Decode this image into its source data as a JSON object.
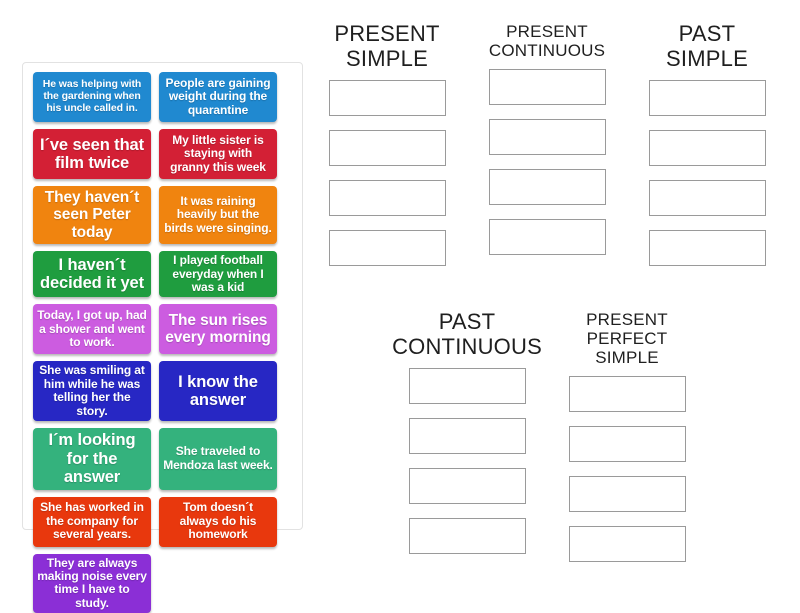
{
  "activity": {
    "type": "drag-and-drop-group-sort",
    "card_bank": {
      "cards": [
        {
          "text": "He was helping with the gardening when his uncle called in.",
          "color": "#2089d0",
          "size": "sm"
        },
        {
          "text": "People are gaining weight during the quarantine",
          "color": "#2089d0",
          "size": "md"
        },
        {
          "text": "I´ve seen that film twice",
          "color": "#d32035",
          "size": "xl"
        },
        {
          "text": "My little sister is staying with granny this week",
          "color": "#d32035",
          "size": "md"
        },
        {
          "text": "They haven´t seen Peter today",
          "color": "#f0840f",
          "size": "lg"
        },
        {
          "text": "It was raining heavily but the birds were singing.",
          "color": "#f0840f",
          "size": "md"
        },
        {
          "text": "I haven´t decided it yet",
          "color": "#1f9d3f",
          "size": "xl"
        },
        {
          "text": "I played football everyday when I was a kid",
          "color": "#1f9d3f",
          "size": "md"
        },
        {
          "text": "Today, I got up, had a shower and went to work.",
          "color": "#cc5ce0",
          "size": "md"
        },
        {
          "text": "The sun rises every morning",
          "color": "#cc5ce0",
          "size": "lg"
        },
        {
          "text": "She was smiling at him while he was telling her the story.",
          "color": "#2727c4",
          "size": "md"
        },
        {
          "text": "I know the answer",
          "color": "#2727c4",
          "size": "xl"
        },
        {
          "text": "I´m looking for the answer",
          "color": "#34b27d",
          "size": "xl"
        },
        {
          "text": "She traveled to Mendoza last week.",
          "color": "#34b27d",
          "size": "md"
        },
        {
          "text": "She has worked in the company for several years.",
          "color": "#e8380d",
          "size": "md"
        },
        {
          "text": "Tom doesn´t always do his homework",
          "color": "#e8380d",
          "size": "md"
        },
        {
          "text": "They are always making noise every time I have to study.",
          "color": "#8b2fd6",
          "size": "md"
        }
      ]
    },
    "groups_top": [
      {
        "title": "PRESENT\nSIMPLE",
        "title_size": "big",
        "slots": 4
      },
      {
        "title": "PRESENT\nCONTINUOUS",
        "title_size": "small",
        "slots": 4
      },
      {
        "title": "PAST\nSIMPLE",
        "title_size": "big",
        "slots": 4
      }
    ],
    "groups_bottom": [
      {
        "title": "PAST\nCONTINUOUS",
        "title_size": "big",
        "slots": 4
      },
      {
        "title": "PRESENT\nPERFECT SIMPLE",
        "title_size": "small",
        "slots": 4
      }
    ]
  }
}
